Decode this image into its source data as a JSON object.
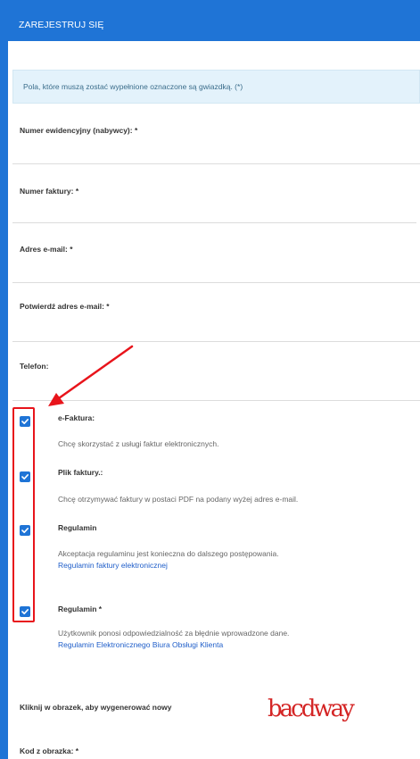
{
  "header": {
    "title": "ZAREJESTRUJ SIĘ"
  },
  "info": {
    "text": "Pola, które muszą zostać wypełnione oznaczone są gwiazdką. (*)"
  },
  "fields": [
    {
      "label": "Numer ewidencyjny (nabywcy): *"
    },
    {
      "label": "Numer faktury: *"
    },
    {
      "label": "Adres e-mail: *"
    },
    {
      "label": "Potwierdź adres e-mail: *"
    },
    {
      "label": "Telefon:"
    }
  ],
  "options": [
    {
      "title": "e-Faktura:",
      "desc": "Chcę skorzystać z usługi faktur elektronicznych.",
      "link": "",
      "checked": true
    },
    {
      "title": "Plik faktury.:",
      "desc": "Chcę otrzymywać faktury w postaci PDF na podany wyżej adres e-mail.",
      "link": "",
      "checked": true
    },
    {
      "title": "Regulamin",
      "desc": "Akceptacja regulaminu jest konieczna do dalszego postępowania.",
      "link": "Regulamin faktury elektronicznej",
      "checked": true
    },
    {
      "title": "Regulamin *",
      "desc": "Użytkownik ponosi odpowiedzialność za błędnie wprowadzone dane.",
      "link": "Regulamin Elektronicznego Biura Obsługi Klienta",
      "checked": true
    }
  ],
  "captcha": {
    "label": "Kliknij w obrazek, aby wygenerować nowy",
    "image_text": "bacdway",
    "code_label": "Kod z obrazka: *"
  },
  "colors": {
    "accent": "#1f74d6",
    "highlight": "#e8141b",
    "captcha": "#d42525"
  }
}
